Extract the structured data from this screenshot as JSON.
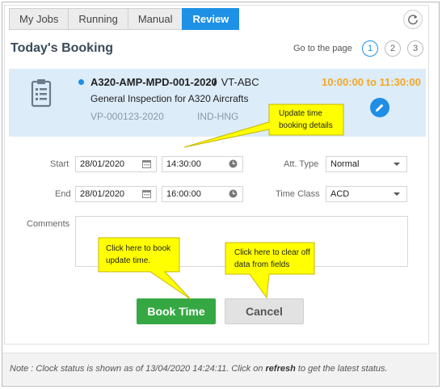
{
  "tabs": [
    {
      "label": "My Jobs",
      "active": false
    },
    {
      "label": "Running",
      "active": false
    },
    {
      "label": "Manual",
      "active": false
    },
    {
      "label": "Review",
      "active": true
    }
  ],
  "refresh_icon": "refresh-icon",
  "section_title": "Today's Booking",
  "pagination": {
    "label": "Go to the page",
    "pages": [
      "1",
      "2",
      "3"
    ],
    "current": "1"
  },
  "booking": {
    "code": "A320-AMP-MPD-001-2020",
    "separator": "/",
    "registration": "VT-ABC",
    "time_range": "10:00:00 to 11:30:00",
    "description": "General Inspection for A320 Aircrafts",
    "vp_number": "VP-000123-2020",
    "station": "IND-HNG",
    "status_color": "#1e8ee6",
    "time_color": "#f5a623"
  },
  "form": {
    "start_label": "Start",
    "start_date": "28/01/2020",
    "start_time": "14:30:00",
    "end_label": "End",
    "end_date": "28/01/2020",
    "end_time": "16:00:00",
    "att_type_label": "Att. Type",
    "att_type_value": "Normal",
    "time_class_label": "Time Class",
    "time_class_value": "ACD",
    "comments_label": "Comments",
    "comments_value": ""
  },
  "buttons": {
    "book": "Book Time",
    "cancel": "Cancel",
    "book_color": "#36a843"
  },
  "note": {
    "prefix": "Note : Clock status is shown as of 13/04/2020  14:24:11. Click on ",
    "link": "refresh",
    "suffix": " to get the latest status."
  },
  "callouts": {
    "update_time_line1": "Update time",
    "update_time_line2": "booking details",
    "book_line1": "Click here to book",
    "book_line2": "update time.",
    "clear_line1": "Click here to clear off",
    "clear_line2": "data from fields",
    "fill_color": "#ffff00"
  }
}
